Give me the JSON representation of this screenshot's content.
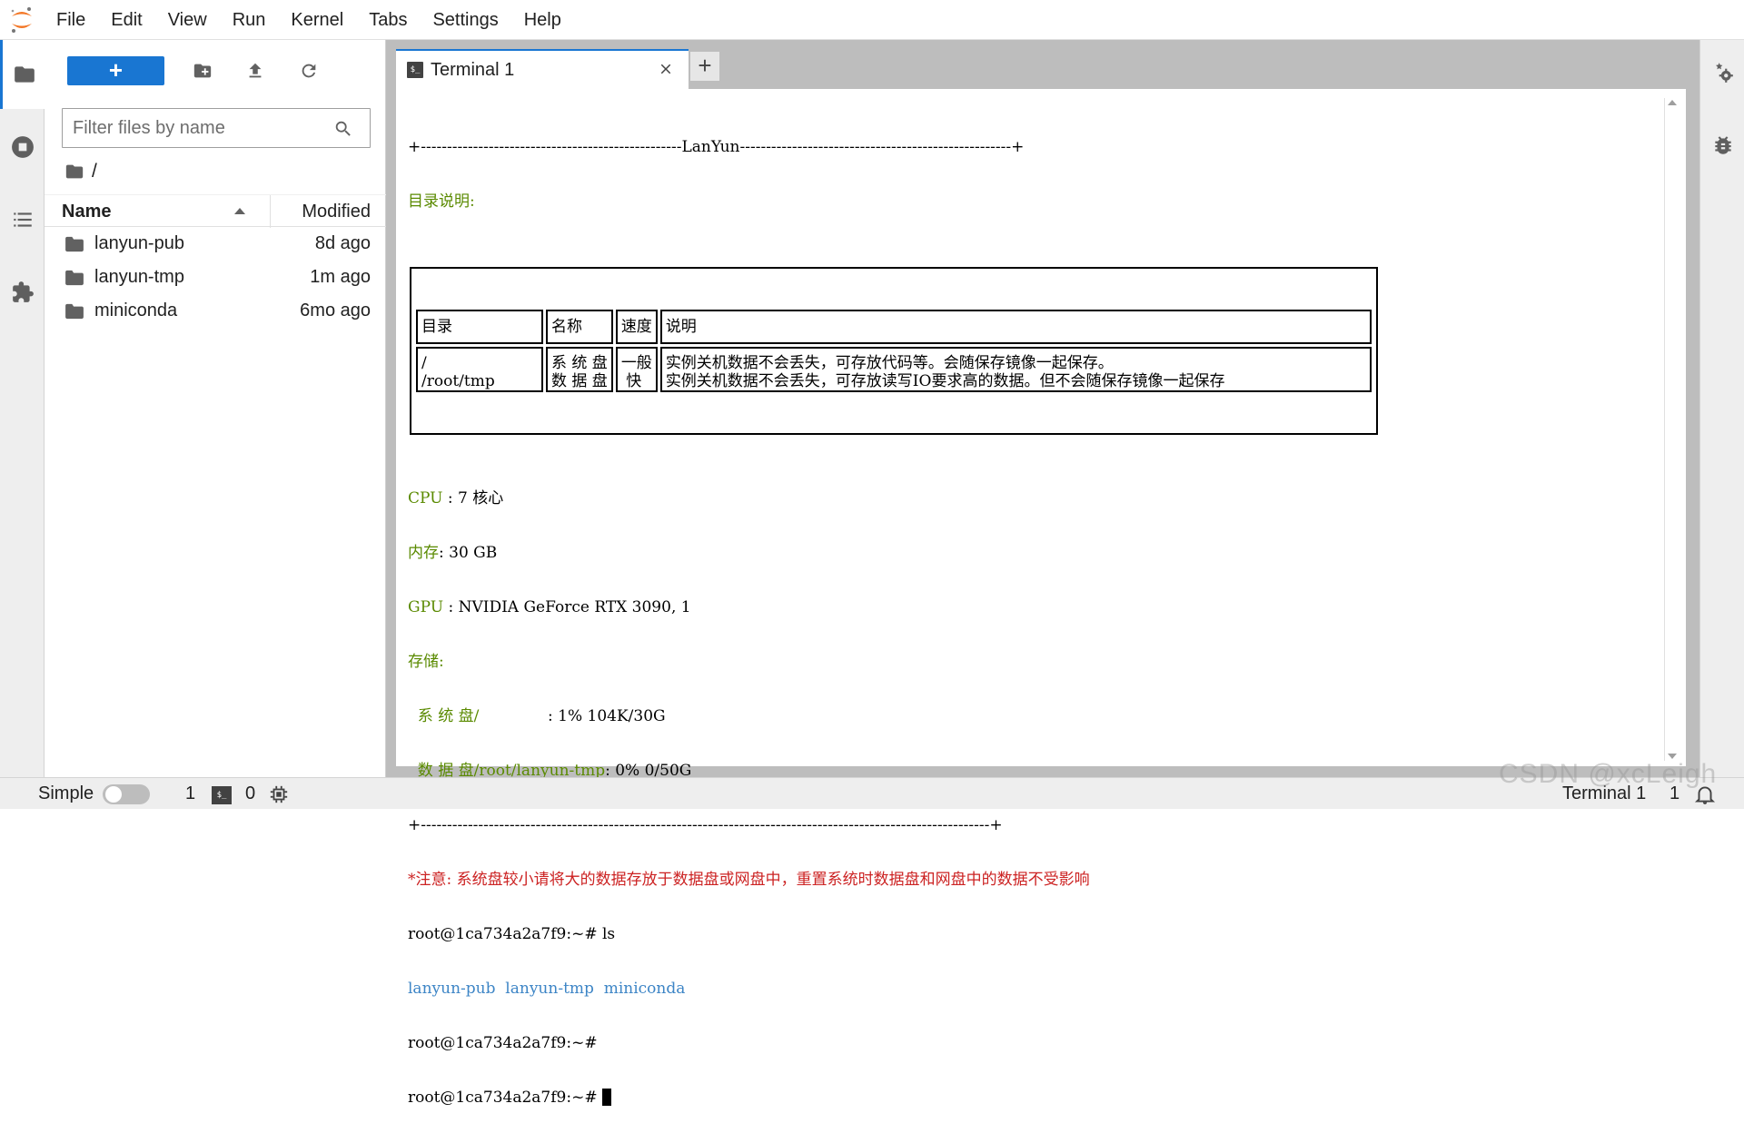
{
  "menubar": {
    "items": [
      "File",
      "Edit",
      "View",
      "Run",
      "Kernel",
      "Tabs",
      "Settings",
      "Help"
    ]
  },
  "left_bar": {
    "items": [
      "folder-icon",
      "running-icon",
      "toc-icon",
      "extension-icon"
    ]
  },
  "filebrowser": {
    "new_label": "+",
    "filter_placeholder": "Filter files by name",
    "breadcrumb": "/",
    "columns": {
      "name": "Name",
      "modified": "Modified"
    },
    "files": [
      {
        "name": "lanyun-pub",
        "modified": "8d ago"
      },
      {
        "name": "lanyun-tmp",
        "modified": "1m ago"
      },
      {
        "name": "miniconda",
        "modified": "6mo ago"
      }
    ]
  },
  "tabs": {
    "active_label": "Terminal 1",
    "new_tab_label": "+"
  },
  "terminal": {
    "border_top": "+--------------------------------------------------LanYun----------------------------------------------------+",
    "dir_title": "目录说明:",
    "table": {
      "headers": [
        "目录",
        "名称",
        "速度",
        "说明"
      ],
      "rows": [
        {
          "dir": "/\n/root/tmp",
          "name": "系 统 盘\n数 据 盘",
          "speed": "一般\n 快",
          "desc": "实例关机数据不会丢失，可存放代码等。会随保存镜像一起保存。\n实例关机数据不会丢失，可存放读写IO要求高的数据。但不会随保存镜像一起保存"
        }
      ]
    },
    "cpu_label": "CPU",
    "cpu_value": " : 7 核心",
    "mem_label": "内存",
    "mem_value": ": 30 GB",
    "gpu_label": "GPU",
    "gpu_value": " : NVIDIA GeForce RTX 3090, 1",
    "storage_label": "存储:",
    "sys_disk_label": "  系 统 盘/",
    "sys_disk_value": "              : 1% 104K/30G",
    "data_disk_label": "  数 据 盘/root/lanyun-tmp",
    "data_disk_value": ": 0% 0/50G",
    "border_bottom": "+-------------------------------------------------------------------------------------------------------------+",
    "notice": "*注意: 系统盘较小请将大的数据存放于数据盘或网盘中，重置系统时数据盘和网盘中的数据不受影响",
    "prompt": "root@1ca734a2a7f9:~# ",
    "cmd_ls": "ls",
    "ls_output": [
      "lanyun-pub",
      "lanyun-tmp",
      "miniconda"
    ],
    "blank_prompt": "root@1ca734a2a7f9:~#"
  },
  "right_bar": {
    "items": [
      "property-inspector-icon",
      "debugger-icon"
    ]
  },
  "statusbar": {
    "simple_label": "Simple",
    "simple_on": false,
    "terminals_count": "1",
    "kernels_count": "0",
    "mode": "Terminal 1",
    "line": "1"
  },
  "watermark": "CSDN @xcLeigh",
  "colors": {
    "accent": "#1976d2",
    "terminal_green": "#5a8a00",
    "terminal_red": "#cc2222",
    "terminal_blue": "#3d85c6"
  }
}
